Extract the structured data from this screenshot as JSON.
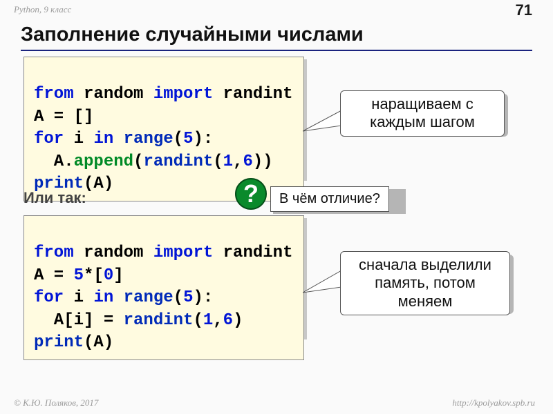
{
  "header": {
    "course": "Python, 9 класс",
    "page": "71"
  },
  "title": "Заполнение случайными числами",
  "code1": {
    "l1a": "from",
    "l1b": " random ",
    "l1c": "import",
    "l1d": " randint",
    "l2": "A = []",
    "l3a": "for",
    "l3b": " i ",
    "l3c": "in",
    "l3d": " ",
    "l3e": "range",
    "l3f": "(",
    "l3g": "5",
    "l3h": "):",
    "l4a": "  A.",
    "l4b": "append",
    "l4c": "(",
    "l4d": "randint",
    "l4e": "(",
    "l4f": "1",
    "l4g": ",",
    "l4h": "6",
    "l4i": "))",
    "l5a": "print",
    "l5b": "(A)"
  },
  "or_label": "Или так:",
  "code2": {
    "l1a": "from",
    "l1b": " random ",
    "l1c": "import",
    "l1d": " randint",
    "l2a": "A = ",
    "l2b": "5",
    "l2c": "*[",
    "l2d": "0",
    "l2e": "]",
    "l3a": "for",
    "l3b": " i ",
    "l3c": "in",
    "l3d": " ",
    "l3e": "range",
    "l3f": "(",
    "l3g": "5",
    "l3h": "):",
    "l4a": "  A[i] = ",
    "l4b": "randint",
    "l4c": "(",
    "l4d": "1",
    "l4e": ",",
    "l4f": "6",
    "l4g": ")",
    "l5a": "print",
    "l5b": "(A)"
  },
  "callout1": "наращиваем с каждым шагом",
  "callout2": "сначала выделили память, потом меняем",
  "question": {
    "mark": "?",
    "text": "В чём отличие?"
  },
  "footer": {
    "author": "© К.Ю. Поляков, 2017",
    "url": "http://kpolyakov.spb.ru"
  }
}
